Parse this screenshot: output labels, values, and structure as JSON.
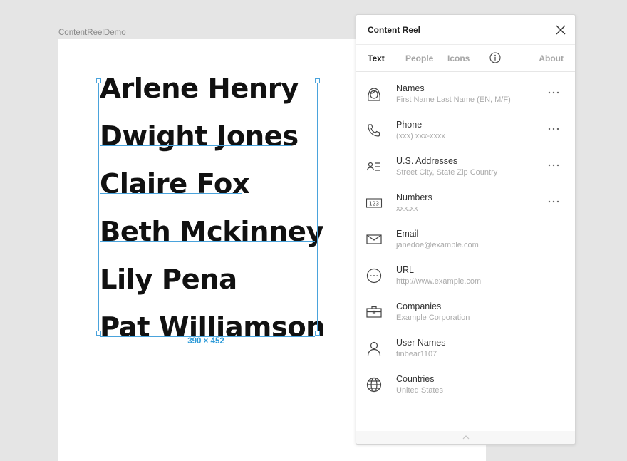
{
  "canvas": {
    "frame_label": "ContentReelDemo",
    "names": [
      "Arlene Henry",
      "Dwight Jones",
      "Claire Fox",
      "Beth Mckinney",
      "Lily Pena",
      "Pat Williamson"
    ],
    "selection_size": "390 × 452"
  },
  "panel": {
    "title": "Content Reel",
    "tabs": {
      "text": "Text",
      "people": "People",
      "icons": "Icons",
      "about": "About"
    },
    "items": [
      {
        "name": "Names",
        "example": "First Name Last Name (EN, M/F)",
        "icon": "person-face-icon",
        "has_more": true
      },
      {
        "name": "Phone",
        "example": "(xxx) xxx-xxxx",
        "icon": "phone-icon",
        "has_more": true
      },
      {
        "name": "U.S. Addresses",
        "example": "Street City, State Zip Country",
        "icon": "address-card-icon",
        "has_more": true
      },
      {
        "name": "Numbers",
        "example": "xxx.xx",
        "icon": "numbers-icon",
        "has_more": true
      },
      {
        "name": "Email",
        "example": "janedoe@example.com",
        "icon": "envelope-icon",
        "has_more": false
      },
      {
        "name": "URL",
        "example": "http://www.example.com",
        "icon": "link-icon",
        "has_more": false
      },
      {
        "name": "Companies",
        "example": "Example Corporation",
        "icon": "briefcase-icon",
        "has_more": false
      },
      {
        "name": "User Names",
        "example": "tinbear1107",
        "icon": "user-icon",
        "has_more": false
      },
      {
        "name": "Countries",
        "example": "United States",
        "icon": "globe-icon",
        "has_more": false
      }
    ]
  },
  "colors": {
    "selection": "#4aa3dc",
    "size_label": "#2c9ad8",
    "background": "#e5e5e5"
  }
}
